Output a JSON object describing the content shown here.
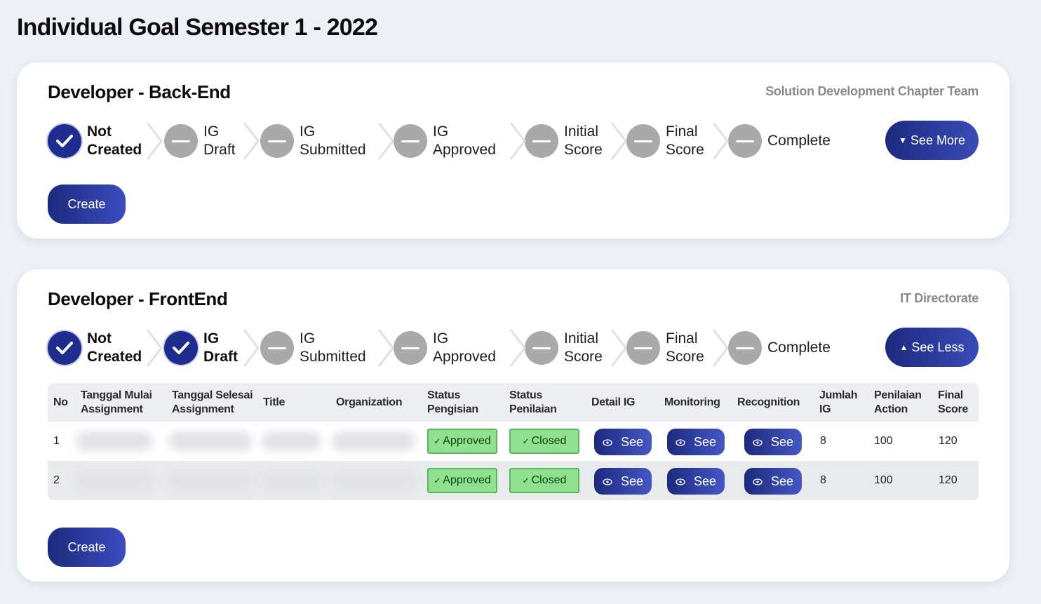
{
  "page": {
    "title": "Individual Goal Semester 1 - 2022"
  },
  "colors": {
    "primary": "#1e2c8e",
    "done": "#1e2c8e",
    "pending": "#a9a9a9",
    "status_green": "#8fe08f"
  },
  "cards": [
    {
      "title": "Developer - Back-End",
      "org": "Solution Development Chapter Team",
      "toggle_label": "See More",
      "toggle_icon": "caret-down-icon",
      "create_label": "Create",
      "steps": [
        {
          "label": "Not\nCreated",
          "state": "done"
        },
        {
          "label": "IG\nDraft",
          "state": "todo"
        },
        {
          "label": "IG\nSubmitted",
          "state": "todo"
        },
        {
          "label": "IG\nApproved",
          "state": "todo"
        },
        {
          "label": "Initial\nScore",
          "state": "todo"
        },
        {
          "label": "Final\nScore",
          "state": "todo"
        },
        {
          "label": "Complete",
          "state": "todo"
        }
      ]
    },
    {
      "title": "Developer - FrontEnd",
      "org": "IT Directorate",
      "toggle_label": "See Less",
      "toggle_icon": "caret-up-icon",
      "create_label": "Create",
      "steps": [
        {
          "label": "Not\nCreated",
          "state": "done"
        },
        {
          "label": "IG\nDraft",
          "state": "done"
        },
        {
          "label": "IG\nSubmitted",
          "state": "todo"
        },
        {
          "label": "IG\nApproved",
          "state": "todo"
        },
        {
          "label": "Initial\nScore",
          "state": "todo"
        },
        {
          "label": "Final\nScore",
          "state": "todo"
        },
        {
          "label": "Complete",
          "state": "todo"
        }
      ],
      "table": {
        "headers": [
          "No",
          "Tanggal Mulai\nAssignment",
          "Tanggal Selesai\nAssignment",
          "Title",
          "Organization",
          "Status\nPengisian",
          "Status\nPenilaian",
          "Detail IG",
          "Monitoring",
          "Recognition",
          "Jumlah\nIG",
          "Penilaian\nAction",
          "Final\nScore"
        ],
        "rows": [
          {
            "no": "1",
            "status_pengisian": "Approved",
            "status_penilaian": "Closed",
            "detail": "See",
            "monitoring": "See",
            "recognition": "See",
            "jumlah_ig": "8",
            "penilaian_action": "100",
            "final_score": "120"
          },
          {
            "no": "2",
            "status_pengisian": "Approved",
            "status_penilaian": "Closed",
            "detail": "See",
            "monitoring": "See",
            "recognition": "See",
            "jumlah_ig": "8",
            "penilaian_action": "100",
            "final_score": "120"
          }
        ]
      }
    }
  ]
}
